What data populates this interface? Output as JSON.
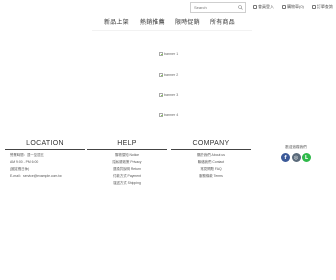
{
  "topbar": {
    "search_placeholder": "Search",
    "links": [
      "會員登入",
      "購物車(0)",
      "訂單查詢"
    ]
  },
  "nav": [
    "新品上架",
    "熱銷推薦",
    "限時促銷",
    "所有商品"
  ],
  "banners": [
    "banner 1",
    "banner 2",
    "banner 3",
    "banner 4"
  ],
  "footer": {
    "location": {
      "title": "LOCATION",
      "lines": [
        "營業時間：週一至週五",
        "AM 9:00 - PM 6:00",
        "(國定假日休)",
        "E-mail：service@example.com.tw"
      ]
    },
    "help": {
      "title": "HELP",
      "links": [
        "購物須知 Notice",
        "隱私權政策 Privacy",
        "退換貨說明 Return",
        "付款方式 Payment",
        "運送方式 Shipping"
      ]
    },
    "company": {
      "title": "COMPANY",
      "links": [
        "關於我們 About us",
        "聯絡我們 Contact",
        "常見問題 FAQ",
        "服務條款 Terms"
      ]
    }
  },
  "social": {
    "title": "歡迎追蹤我們",
    "icons": [
      {
        "name": "facebook-icon",
        "glyph": "f",
        "color": "#3b5998"
      },
      {
        "name": "instagram-icon",
        "glyph": "◎",
        "color": "#5a6a7a"
      },
      {
        "name": "line-icon",
        "glyph": "L",
        "color": "#2fb94a"
      }
    ]
  }
}
